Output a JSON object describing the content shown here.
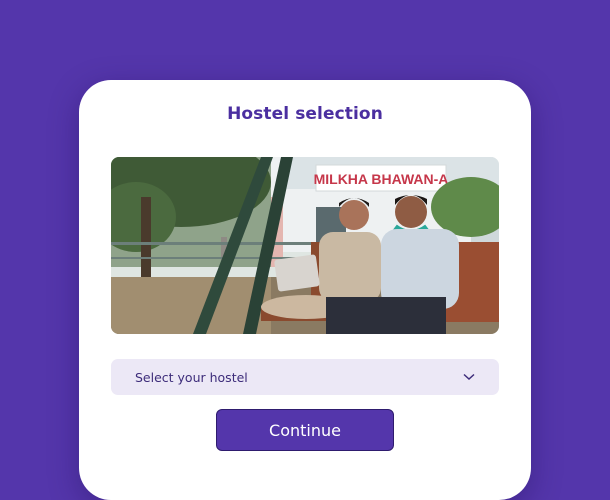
{
  "dialog": {
    "title": "Hostel selection",
    "photo": {
      "sign_text": "MILKHA BHAWAN-A"
    },
    "hostel_select": {
      "placeholder": "Select your hostel",
      "icon": "chevron-down-icon"
    },
    "continue_label": "Continue"
  },
  "colors": {
    "background": "#5436ab",
    "title": "#4b2fa0",
    "select_bg": "#ece8f6",
    "button_bg": "#5436ab"
  }
}
